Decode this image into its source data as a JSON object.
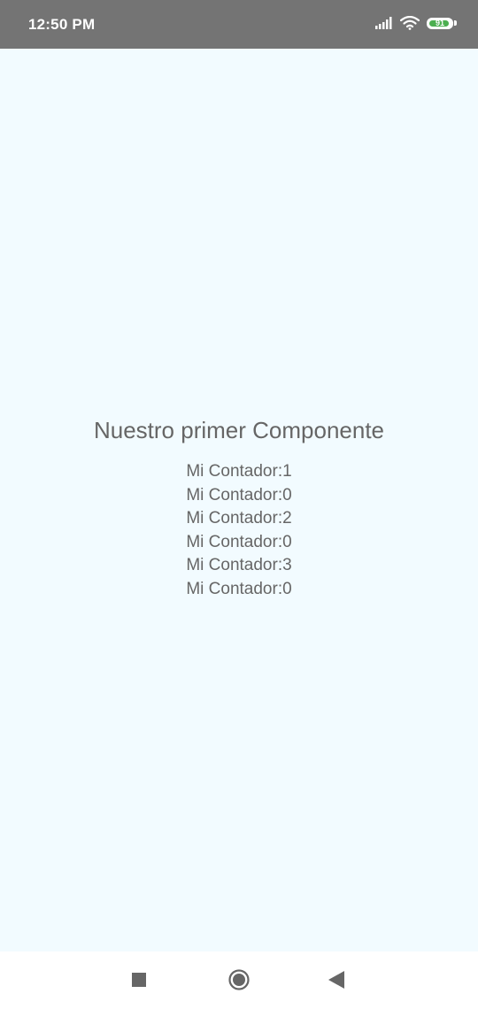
{
  "status_bar": {
    "time": "12:50 PM",
    "battery_level": "91",
    "battery_percent": 91,
    "icons": [
      "signal-icon",
      "wifi-icon",
      "battery-icon"
    ],
    "colors": {
      "background": "#747474",
      "battery_fill": "#4caf50"
    }
  },
  "main": {
    "title": "Nuestro primer Componente",
    "counters": [
      {
        "label": "Mi Contador:1"
      },
      {
        "label": "Mi Contador:0"
      },
      {
        "label": "Mi Contador:2"
      },
      {
        "label": "Mi Contador:0"
      },
      {
        "label": "Mi Contador:3"
      },
      {
        "label": "Mi Contador:0"
      }
    ],
    "colors": {
      "background": "#f2fbff",
      "text": "#666666"
    }
  },
  "nav_bar": {
    "buttons": [
      "recents-icon",
      "home-icon",
      "back-icon"
    ]
  }
}
